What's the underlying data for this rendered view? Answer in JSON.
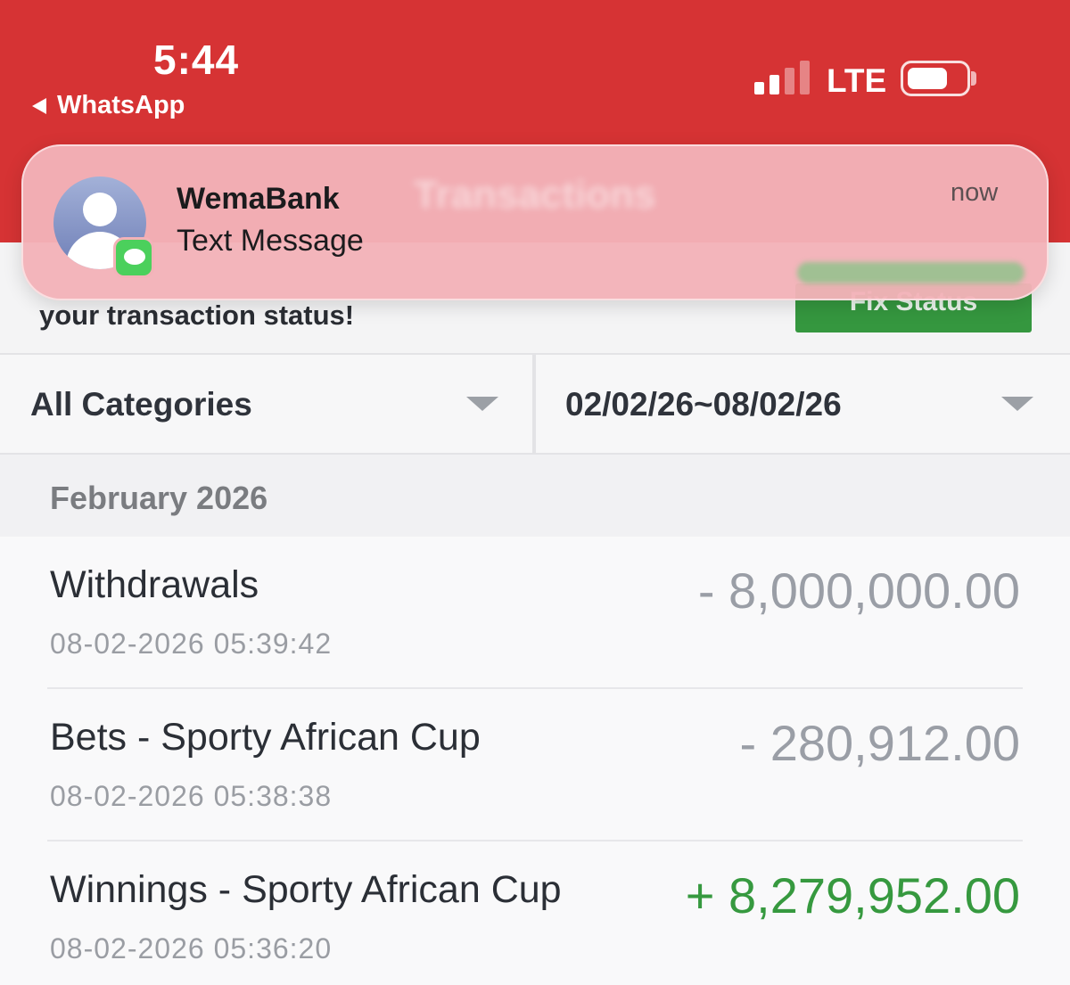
{
  "status_bar": {
    "time": "5:44",
    "back_app": "WhatsApp",
    "network": "LTE"
  },
  "notification": {
    "sender": "WemaBank",
    "body": "Text Message",
    "time": "now",
    "icon": "messages-icon"
  },
  "banner": {
    "text": "your transaction status!",
    "button_label": "Fix Status"
  },
  "filters": {
    "category": "All Categories",
    "date_range": "02/02/26~08/02/26"
  },
  "month_label": "February 2026",
  "transactions": [
    {
      "title": "Withdrawals",
      "time": "08-02-2026 05:39:42",
      "amount": "- 8,000,000.00"
    },
    {
      "title": "Bets - Sporty African Cup",
      "time": "08-02-2026 05:38:38",
      "amount": "- 280,912.00"
    },
    {
      "title": "Winnings - Sporty African Cup",
      "time": "08-02-2026 05:36:20",
      "amount": "+ 8,279,952.00"
    }
  ],
  "colors": {
    "header_red": "#d63334",
    "positive_green": "#36993f",
    "negative_gray": "#9a9ea6",
    "button_green": "#35973f"
  }
}
